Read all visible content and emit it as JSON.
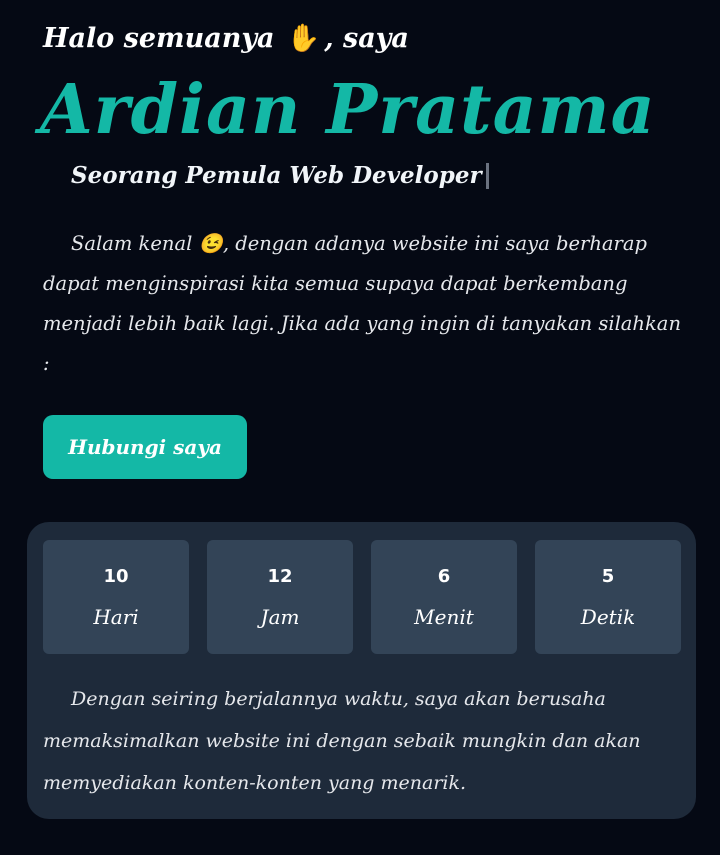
{
  "hero": {
    "greeting_before": "Halo semuanya",
    "greeting_emoji": "✋",
    "greeting_after": ", saya",
    "name": "Ardian Pratama",
    "subtitle": "Seorang Pemula Web Developer"
  },
  "intro": {
    "text_before": "Salam kenal",
    "emoji": "😉",
    "text_after": ", dengan adanya website ini saya berharap dapat menginspirasi kita semua supaya dapat berkembang menjadi lebih baik lagi. Jika ada yang ingin di tanyakan silahkan :"
  },
  "contact_button": {
    "label": "Hubungi saya"
  },
  "countdown": [
    {
      "value": "10",
      "unit": "Hari"
    },
    {
      "value": "12",
      "unit": "Jam"
    },
    {
      "value": "6",
      "unit": "Menit"
    },
    {
      "value": "5",
      "unit": "Detik"
    }
  ],
  "outro": {
    "text": "Dengan seiring berjalannya waktu, saya akan berusaha memaksimalkan website ini dengan sebaik mungkin dan akan memyediakan konten-konten yang menarik."
  },
  "colors": {
    "background": "#050914",
    "accent": "#14b8a6",
    "panel": "#1e2a3a",
    "box": "#334457"
  }
}
